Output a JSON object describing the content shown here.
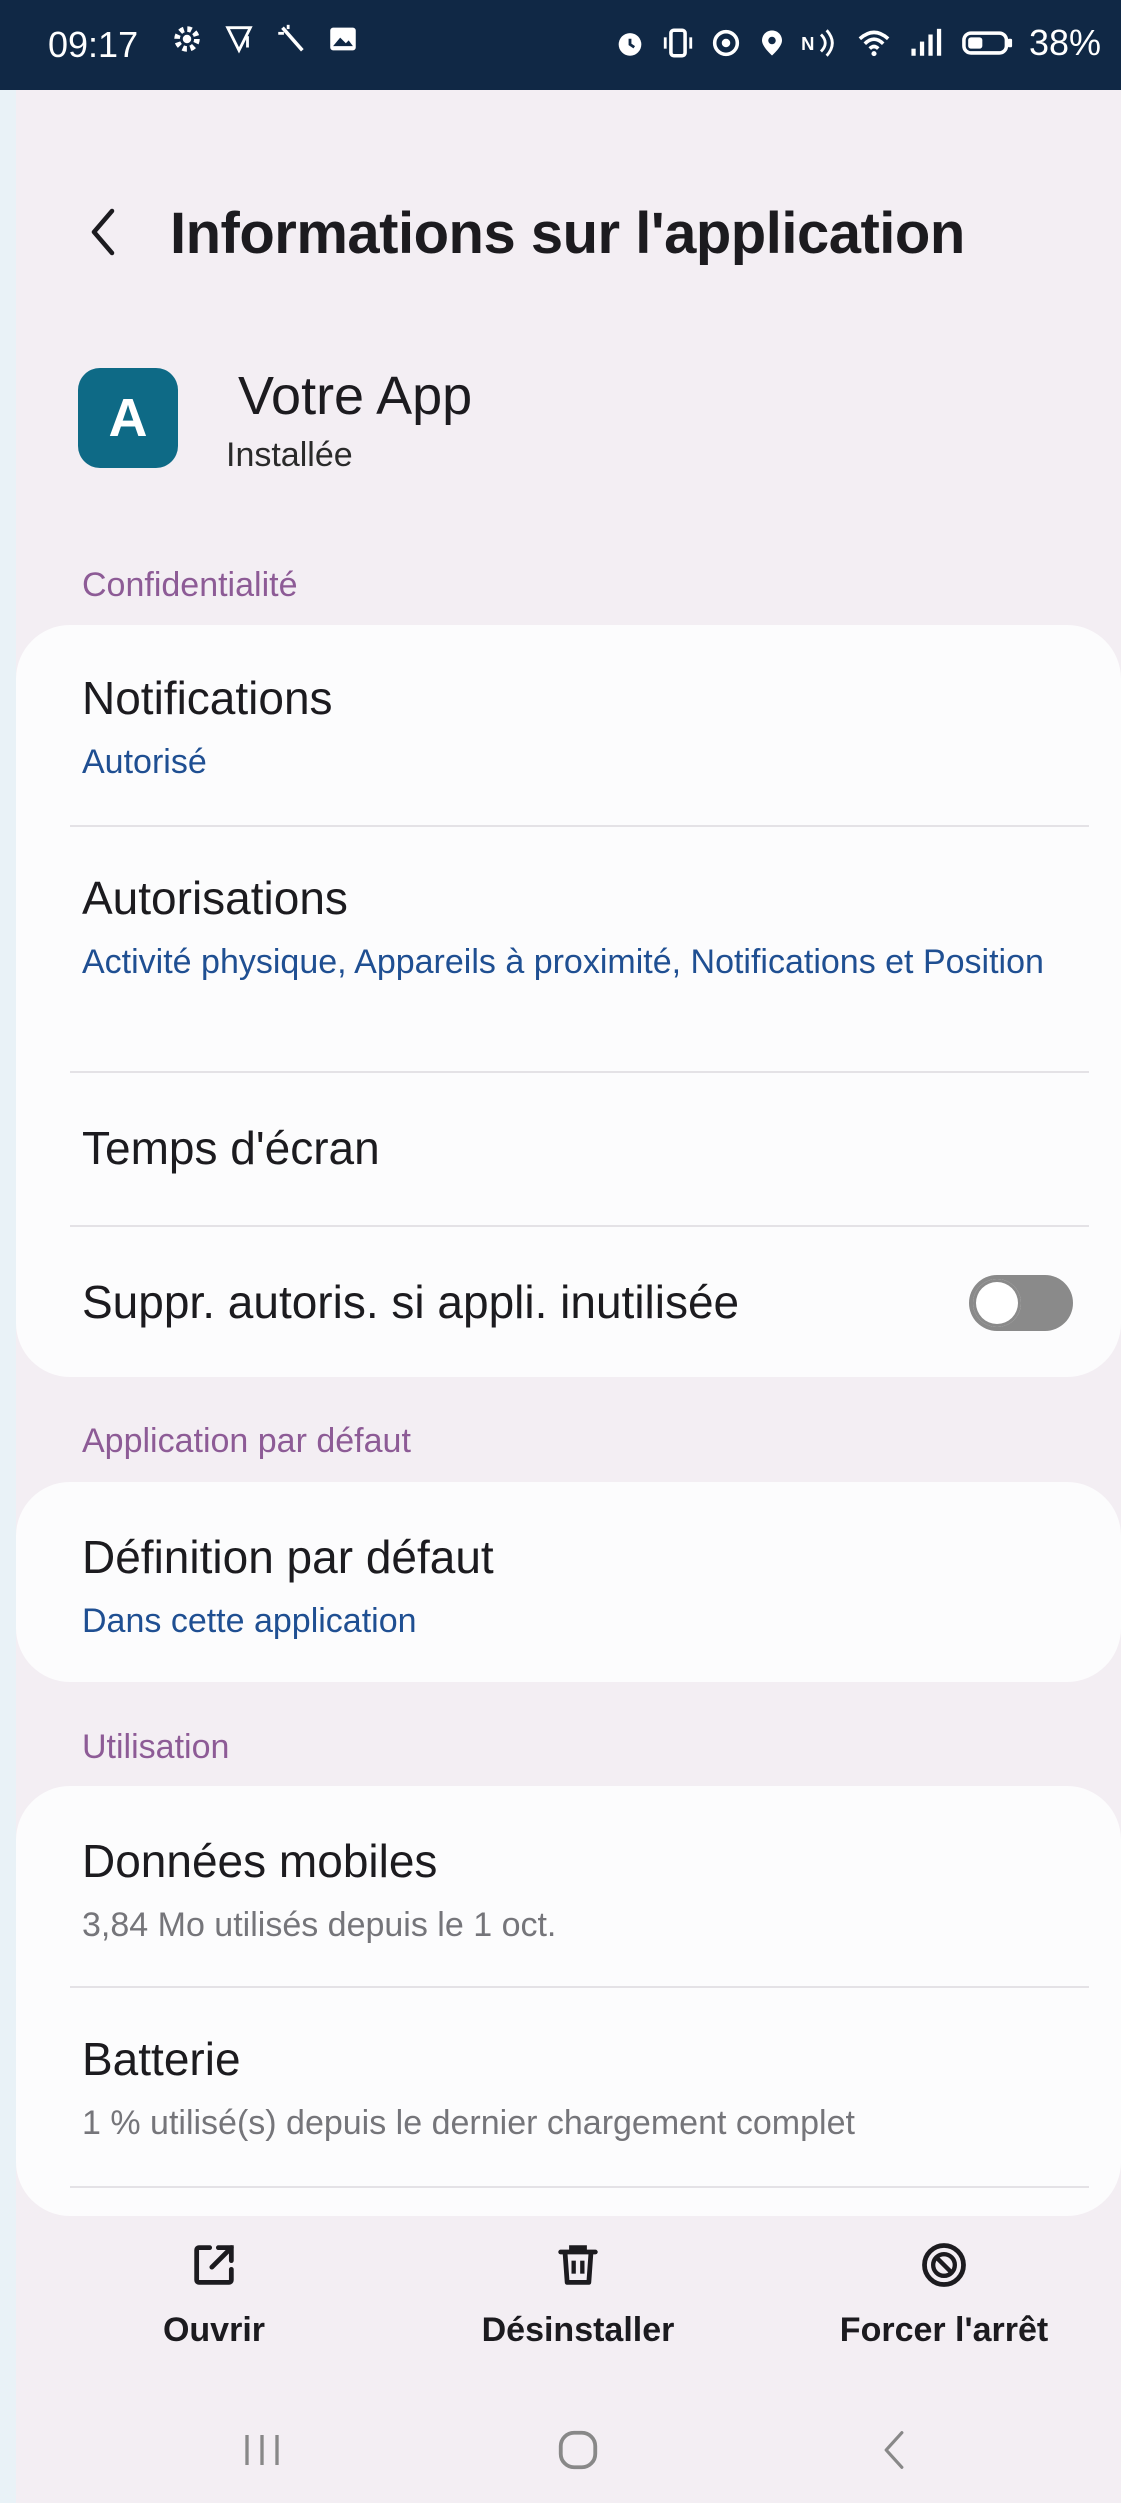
{
  "status_bar": {
    "time": "09:17",
    "battery": "38%",
    "icons_left": [
      "gear-icon",
      "wifi-call-icon",
      "magic-wand-icon",
      "image-icon"
    ],
    "icons_right": [
      "alarm-icon",
      "vibrate-icon",
      "sync-icon",
      "location-icon",
      "volte-icon",
      "wifi-icon",
      "signal-icon",
      "battery-icon"
    ]
  },
  "header": {
    "title": "Informations sur l'application"
  },
  "app": {
    "icon_letter": "A",
    "name": "Votre App",
    "status": "Installée",
    "icon_color": "#0e6a86"
  },
  "sections": {
    "privacy": {
      "label": "Confidentialité",
      "notifications": {
        "title": "Notifications",
        "value": "Autorisé"
      },
      "permissions": {
        "title": "Autorisations",
        "value": "Activité physique, Appareils à proximité, Notifications et Position"
      },
      "screen_time": {
        "title": "Temps d'écran"
      },
      "remove_permissions": {
        "title": "Suppr. autoris. si appli. inutilisée",
        "enabled": false
      }
    },
    "default_app": {
      "label": "Application par défaut",
      "set_default": {
        "title": "Définition par défaut",
        "value": "Dans cette application"
      }
    },
    "usage": {
      "label": "Utilisation",
      "mobile_data": {
        "title": "Données mobiles",
        "value": "3,84 Mo utilisés depuis le 1 oct."
      },
      "battery": {
        "title": "Batterie",
        "value": "1 % utilisé(s) depuis le dernier chargement complet"
      }
    }
  },
  "actions": {
    "open": "Ouvrir",
    "uninstall": "Désinstaller",
    "force_stop": "Forcer l'arrêt"
  },
  "colors": {
    "accent_link": "#1f4f92",
    "section_label": "#8d5b96",
    "status_bar_bg": "#102845"
  }
}
